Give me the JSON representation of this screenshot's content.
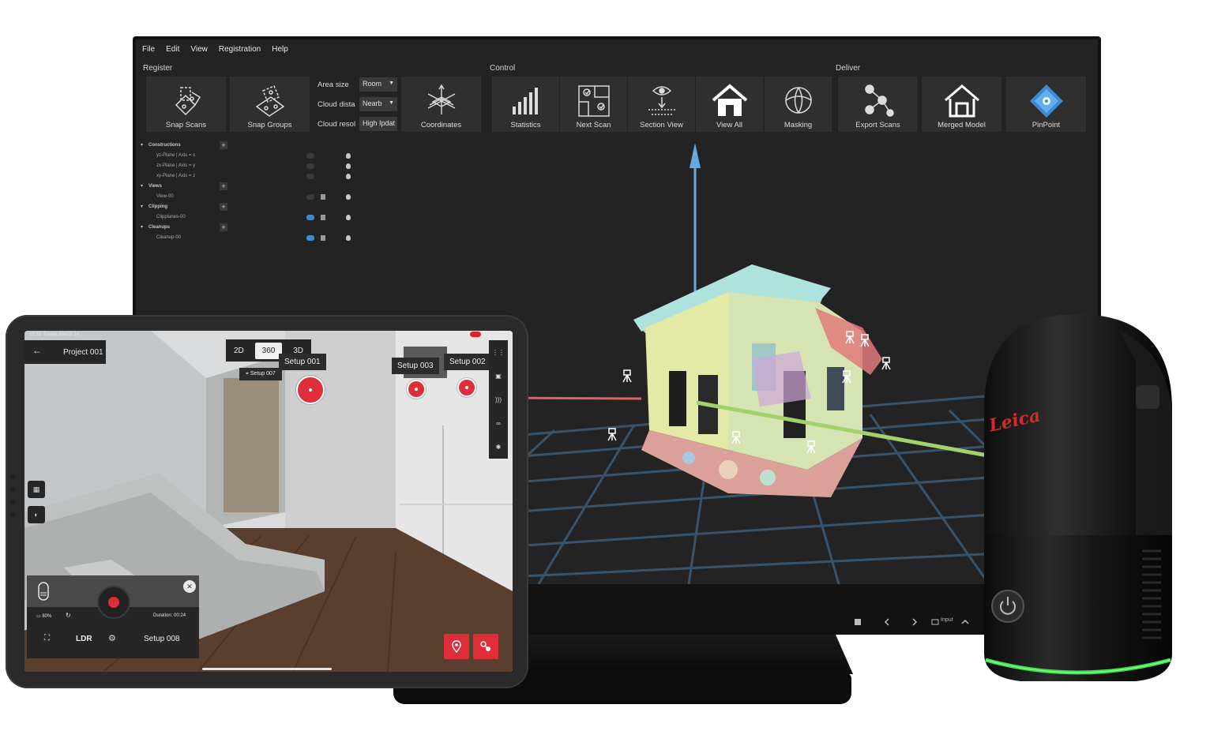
{
  "desktop": {
    "menu": [
      "File",
      "Edit",
      "View",
      "Registration",
      "Help"
    ],
    "groups": {
      "register": "Register",
      "control": "Control",
      "deliver": "Deliver"
    },
    "register_buttons": {
      "snap_scans": "Snap Scans",
      "snap_groups": "Snap Groups",
      "coordinates": "Coordinates"
    },
    "fields": [
      {
        "label": "Area size",
        "value": "Room"
      },
      {
        "label": "Cloud dista",
        "value": "Nearb"
      },
      {
        "label": "Cloud resol",
        "value": "High Ipdat"
      }
    ],
    "control_buttons": {
      "statistics": "Statistics",
      "next_scan": "Next Scan",
      "section_view": "Section View",
      "view_all": "View All",
      "masking": "Masking"
    },
    "deliver_buttons": {
      "export_scans": "Export Scans",
      "merged_model": "Merged Model",
      "pinpoint": "PinPoint"
    },
    "tree": {
      "constructions": "Constructions",
      "yz_plane": "yz-Plane | Axis = x",
      "zx_plane": "zx-Plane | Axis = y",
      "xy_plane": "xy-Plane | Axis = z",
      "views": "Views",
      "view_00": "View-00",
      "clipping": "Clipping",
      "clipplanes_00": "Clipplanes-00",
      "cleanups": "Cleanups",
      "cleanup_00": "Cleanup-00"
    },
    "statusbar": {
      "input": "Input"
    }
  },
  "tablet": {
    "time": "15:31",
    "date": "Friday, March 14",
    "battery": "90 %",
    "project": "Project 001",
    "modes": {
      "m2d": "2D",
      "m360": "360",
      "m3d": "3D"
    },
    "setups": {
      "s001": "Setup 001",
      "s003": "Setup 003",
      "s002": "Setup 002",
      "s007": "Setup 007"
    },
    "panel": {
      "battery": "80%",
      "duration": "Duration: 00:24",
      "ldr": "LDR",
      "setup": "Setup 008"
    }
  },
  "scanner": {
    "brand": "Leica"
  },
  "colors": {
    "accent_red": "#e02d3a",
    "pinpoint_blue": "#3d8ad0",
    "scanner_ring": "#39e04a"
  }
}
